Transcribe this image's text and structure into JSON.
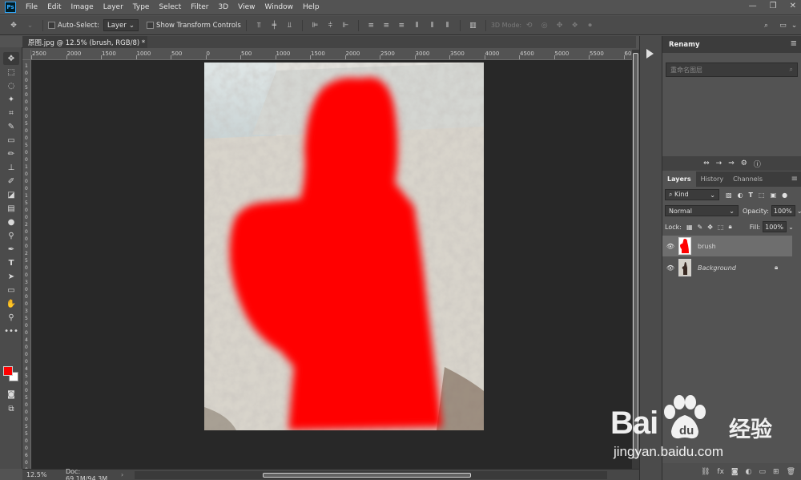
{
  "app": {
    "logo_text": "Ps"
  },
  "menu": [
    "File",
    "Edit",
    "Image",
    "Layer",
    "Type",
    "Select",
    "Filter",
    "3D",
    "View",
    "Window",
    "Help"
  ],
  "options": {
    "auto_select_label": "Auto-Select:",
    "auto_select_target": "Layer",
    "show_transform_label": "Show Transform Controls",
    "mode_3d_label": "3D Mode:"
  },
  "document": {
    "tab_title": "原图.jpg @ 12.5% (brush, RGB/8) *",
    "tab_close": "×",
    "ruler_h": [
      "2500",
      "2000",
      "1500",
      "1000",
      "500",
      "0",
      "500",
      "1000",
      "1500",
      "2000",
      "2500",
      "3000",
      "3500",
      "4000",
      "4500",
      "5000",
      "5500",
      "60"
    ],
    "ruler_v": [
      "1",
      "0",
      "0",
      "5",
      "0",
      "0",
      "0",
      "0",
      "5",
      "0",
      "0",
      "5",
      "0",
      "0",
      "1",
      "0",
      "0",
      "0",
      "1",
      "5",
      "0",
      "0",
      "2",
      "0",
      "0",
      "0",
      "2",
      "5",
      "0",
      "0",
      "3",
      "0",
      "0",
      "0",
      "3",
      "5",
      "0",
      "0",
      "4",
      "0",
      "0",
      "0",
      "4",
      "5",
      "0",
      "0",
      "5",
      "0",
      "0",
      "0",
      "5",
      "5",
      "0",
      "0",
      "6",
      "0",
      "0",
      "0"
    ]
  },
  "status": {
    "zoom": "12.5%",
    "doc_info": "Doc: 69.1M/94.3M",
    "arrow": "›"
  },
  "colors": {
    "foreground": "#ff0000",
    "background": "#ffffff",
    "accent": "#31a8ff"
  },
  "panels": {
    "renamy_title": "Renamy",
    "renamy_placeholder": "重命名图层",
    "layers_tabs": [
      "Layers",
      "History",
      "Channels"
    ],
    "kind_label": "Kind",
    "blend_mode": "Normal",
    "opacity_label": "Opacity:",
    "opacity_value": "100%",
    "lock_label": "Lock:",
    "fill_label": "Fill:",
    "fill_value": "100%",
    "layers": [
      {
        "name": "brush",
        "selected": true
      },
      {
        "name": "Background",
        "locked": true
      }
    ]
  },
  "watermark": {
    "brand": "Bai",
    "brand_suffix": "du",
    "cn": "经验",
    "url": "jingyan.baidu.com"
  }
}
